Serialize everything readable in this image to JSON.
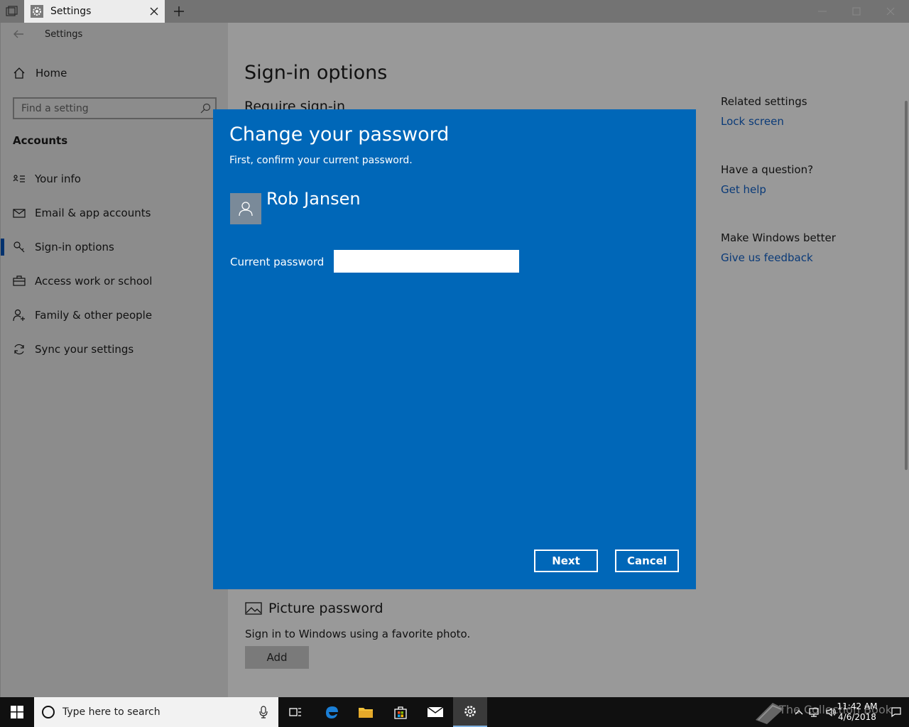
{
  "tab": {
    "title": "Settings"
  },
  "app": {
    "title": "Settings"
  },
  "sidebar": {
    "home_label": "Home",
    "search_placeholder": "Find a setting",
    "section_title": "Accounts",
    "items": [
      {
        "label": "Your info",
        "icon": "contact-card-icon",
        "active": false
      },
      {
        "label": "Email & app accounts",
        "icon": "mail-icon",
        "active": false
      },
      {
        "label": "Sign-in options",
        "icon": "key-icon",
        "active": true
      },
      {
        "label": "Access work or school",
        "icon": "briefcase-icon",
        "active": false
      },
      {
        "label": "Family & other people",
        "icon": "person-add-icon",
        "active": false
      },
      {
        "label": "Sync your settings",
        "icon": "sync-icon",
        "active": false
      }
    ]
  },
  "main": {
    "page_title": "Sign-in options",
    "require_title": "Require sign-in",
    "related": {
      "heading1": "Related settings",
      "link1": "Lock screen",
      "heading2": "Have a question?",
      "link2": "Get help",
      "heading3": "Make Windows better",
      "link3": "Give us feedback"
    },
    "picture_password": {
      "title": "Picture password",
      "description": "Sign in to Windows using a favorite photo.",
      "add_label": "Add"
    }
  },
  "dialog": {
    "title": "Change your password",
    "subtitle": "First, confirm your current password.",
    "user_name": "Rob Jansen",
    "password_label": "Current password",
    "password_value": "",
    "next_label": "Next",
    "cancel_label": "Cancel",
    "bg_color": "#0067b8"
  },
  "taskbar": {
    "search_placeholder": "Type here to search",
    "time": "11:42 AM",
    "date": "4/6/2018",
    "watermark": "The Collection Book"
  }
}
